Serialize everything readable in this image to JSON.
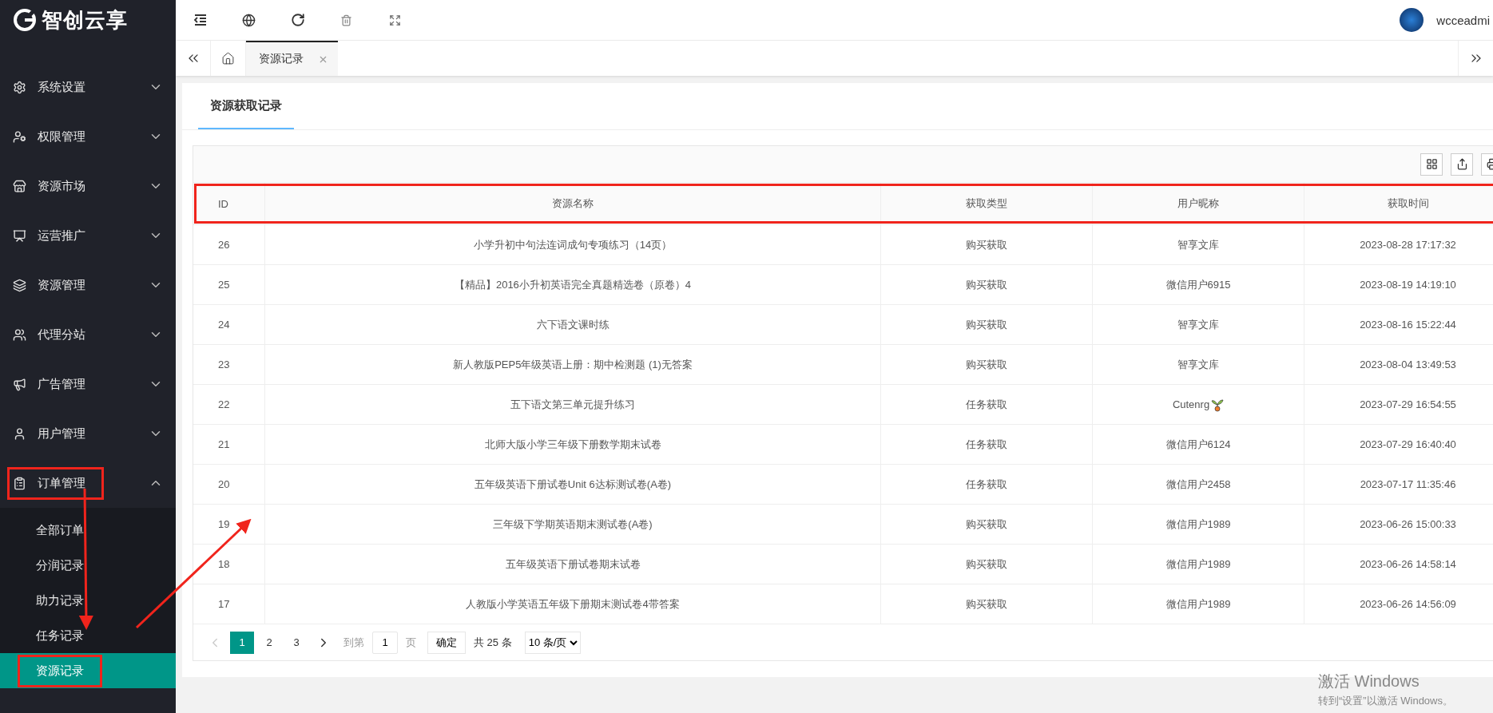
{
  "brand": {
    "name": "智创云享"
  },
  "sidebar": {
    "items": [
      {
        "label": "系统设置",
        "expanded": false,
        "highlighted": false
      },
      {
        "label": "权限管理",
        "expanded": false,
        "highlighted": false
      },
      {
        "label": "资源市场",
        "expanded": false,
        "highlighted": false
      },
      {
        "label": "运营推广",
        "expanded": false,
        "highlighted": false
      },
      {
        "label": "资源管理",
        "expanded": false,
        "highlighted": false
      },
      {
        "label": "代理分站",
        "expanded": false,
        "highlighted": false
      },
      {
        "label": "广告管理",
        "expanded": false,
        "highlighted": false
      },
      {
        "label": "用户管理",
        "expanded": false,
        "highlighted": false
      },
      {
        "label": "订单管理",
        "expanded": true,
        "highlighted": true,
        "children": [
          {
            "label": "全部订单",
            "selected": false,
            "highlighted": false
          },
          {
            "label": "分润记录",
            "selected": false,
            "highlighted": false
          },
          {
            "label": "助力记录",
            "selected": false,
            "highlighted": false
          },
          {
            "label": "任务记录",
            "selected": false,
            "highlighted": false
          },
          {
            "label": "资源记录",
            "selected": true,
            "highlighted": true
          }
        ]
      }
    ]
  },
  "header": {
    "user": "wcceadmi"
  },
  "page_tabs": [
    {
      "label": "资源记录",
      "selected": true
    }
  ],
  "card": {
    "tabs": [
      {
        "label": "资源获取记录",
        "selected": true
      }
    ]
  },
  "table": {
    "header_highlighted": true,
    "columns": [
      "ID",
      "资源名称",
      "获取类型",
      "用户昵称",
      "获取时间"
    ],
    "rows": [
      {
        "id": "26",
        "name": "小学升初中句法连词成句专项练习（14页）",
        "type": "购买获取",
        "user": "智享文库",
        "user_icon": false,
        "time": "2023-08-28 17:17:32"
      },
      {
        "id": "25",
        "name": "【精品】2016小升初英语完全真题精选卷（原卷）4",
        "type": "购买获取",
        "user": "微信用户6915",
        "user_icon": false,
        "time": "2023-08-19 14:19:10"
      },
      {
        "id": "24",
        "name": "六下语文课时练",
        "type": "购买获取",
        "user": "智享文库",
        "user_icon": false,
        "time": "2023-08-16 15:22:44"
      },
      {
        "id": "23",
        "name": "新人教版PEP5年级英语上册：期中检测题 (1)无答案",
        "type": "购买获取",
        "user": "智享文库",
        "user_icon": false,
        "time": "2023-08-04 13:49:53"
      },
      {
        "id": "22",
        "name": "五下语文第三单元提升练习",
        "type": "任务获取",
        "user": "Cutenrg",
        "user_icon": true,
        "time": "2023-07-29 16:54:55"
      },
      {
        "id": "21",
        "name": "北师大版小学三年级下册数学期末试卷",
        "type": "任务获取",
        "user": "微信用户6124",
        "user_icon": false,
        "time": "2023-07-29 16:40:40"
      },
      {
        "id": "20",
        "name": "五年级英语下册试卷Unit 6达标测试卷(A卷)",
        "type": "任务获取",
        "user": "微信用户2458",
        "user_icon": false,
        "time": "2023-07-17 11:35:46"
      },
      {
        "id": "19",
        "name": "三年级下学期英语期末测试卷(A卷)",
        "type": "购买获取",
        "user": "微信用户1989",
        "user_icon": false,
        "time": "2023-06-26 15:00:33"
      },
      {
        "id": "18",
        "name": "五年级英语下册试卷期末试卷",
        "type": "购买获取",
        "user": "微信用户1989",
        "user_icon": false,
        "time": "2023-06-26 14:58:14"
      },
      {
        "id": "17",
        "name": "人教版小学英语五年级下册期末测试卷4带答案",
        "type": "购买获取",
        "user": "微信用户1989",
        "user_icon": false,
        "time": "2023-06-26 14:56:09"
      }
    ]
  },
  "pagination": {
    "pages": [
      {
        "label": "1",
        "selected": true
      },
      {
        "label": "2",
        "selected": false
      },
      {
        "label": "3",
        "selected": false
      }
    ],
    "prev_disabled": true,
    "goto_label": "到第",
    "goto_value": "1",
    "page_unit": "页",
    "confirm": "确定",
    "total": "共 25 条",
    "page_size": "10 条/页"
  },
  "annotation_arrows": true,
  "os_notice": {
    "title": "激活 Windows",
    "text": "转到“设置”以激活 Windows。"
  }
}
